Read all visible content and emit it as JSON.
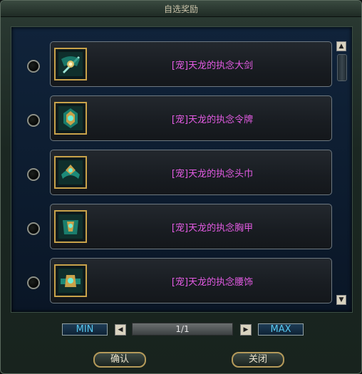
{
  "window": {
    "title": "自选奖励"
  },
  "items": [
    {
      "name": "[宠]天龙的执念大剑",
      "icon": "sword-crest-icon"
    },
    {
      "name": "[宠]天龙的执念令牌",
      "icon": "token-crest-icon"
    },
    {
      "name": "[宠]天龙的执念头巾",
      "icon": "headband-crest-icon"
    },
    {
      "name": "[宠]天龙的执念胸甲",
      "icon": "armor-crest-icon"
    },
    {
      "name": "[宠]天龙的执念腰饰",
      "icon": "belt-crest-icon"
    }
  ],
  "pager": {
    "min_label": "MIN",
    "max_label": "MAX",
    "page": "1/1"
  },
  "actions": {
    "confirm_label": "确认",
    "close_label": "关闭"
  },
  "colors": {
    "item_name": "#e35be3",
    "frame_gold": "#c9a24a",
    "minmax_text": "#56c8f0"
  }
}
